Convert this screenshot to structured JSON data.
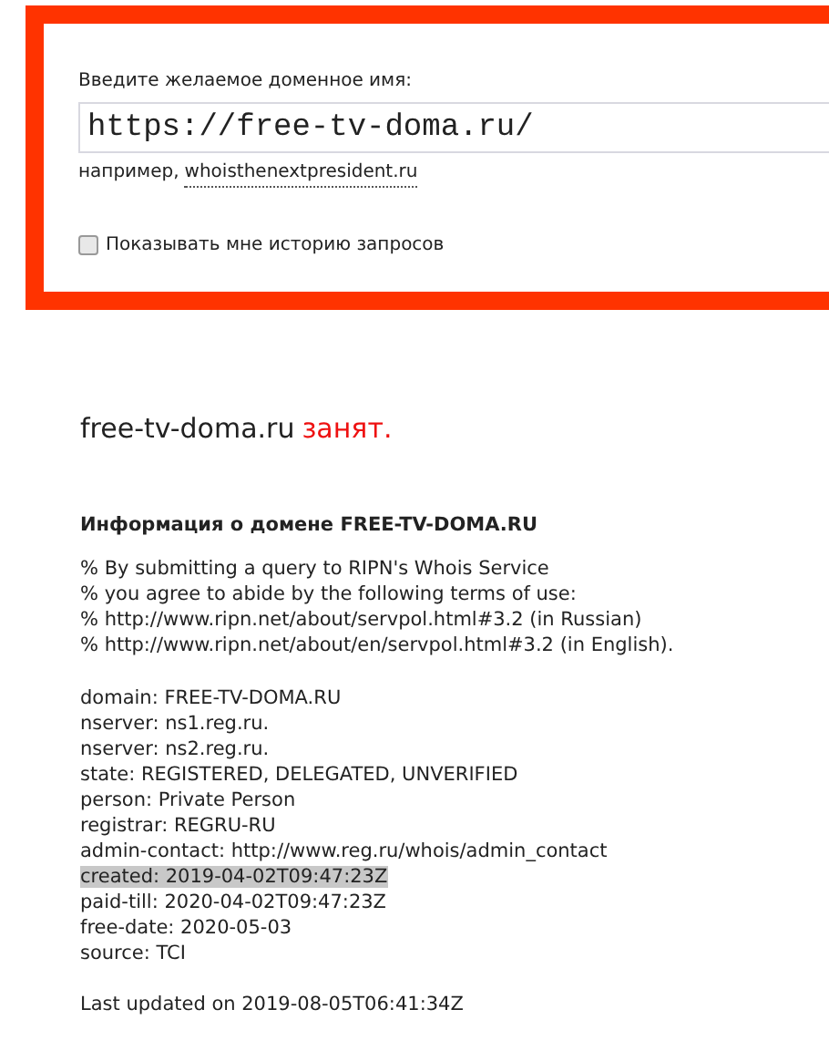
{
  "form": {
    "label": "Введите желаемое доменное имя:",
    "domain_input": {
      "value": "https://free-tv-doma.ru/"
    },
    "example_prefix": "например,",
    "example_link": "whoisthenextpresident.ru",
    "history_checkbox": {
      "label": "Показывать мне историю запросов",
      "checked": false
    }
  },
  "result": {
    "domain": "free-tv-doma.ru",
    "status": "занят."
  },
  "info": {
    "title": "Информация о домене FREE-TV-DOMA.RU",
    "notice_lines": [
      {
        "text": "% By submitting a query to RIPN's Whois Service",
        "highlighted": false
      },
      {
        "text": "% you agree to abide by the following terms of use:",
        "highlighted": false
      },
      {
        "text": "% http://www.ripn.net/about/servpol.html#3.2 (in Russian)",
        "highlighted": false
      },
      {
        "text": "% http://www.ripn.net/about/en/servpol.html#3.2 (in English).",
        "highlighted": false
      }
    ],
    "record_lines": [
      {
        "text": "domain: FREE-TV-DOMA.RU",
        "highlighted": false
      },
      {
        "text": "nserver: ns1.reg.ru.",
        "highlighted": false
      },
      {
        "text": "nserver: ns2.reg.ru.",
        "highlighted": false
      },
      {
        "text": "state: REGISTERED, DELEGATED, UNVERIFIED",
        "highlighted": false
      },
      {
        "text": "person: Private Person",
        "highlighted": false
      },
      {
        "text": "registrar: REGRU-RU",
        "highlighted": false
      },
      {
        "text": "admin-contact: http://www.reg.ru/whois/admin_contact",
        "highlighted": false
      },
      {
        "text": "created: 2019-04-02T09:47:23Z",
        "highlighted": true
      },
      {
        "text": "paid-till: 2020-04-02T09:47:23Z",
        "highlighted": false
      },
      {
        "text": "free-date: 2020-05-03",
        "highlighted": false
      },
      {
        "text": "source: TCI",
        "highlighted": false
      }
    ],
    "last_updated": "Last updated on 2019-08-05T06:41:34Z"
  }
}
